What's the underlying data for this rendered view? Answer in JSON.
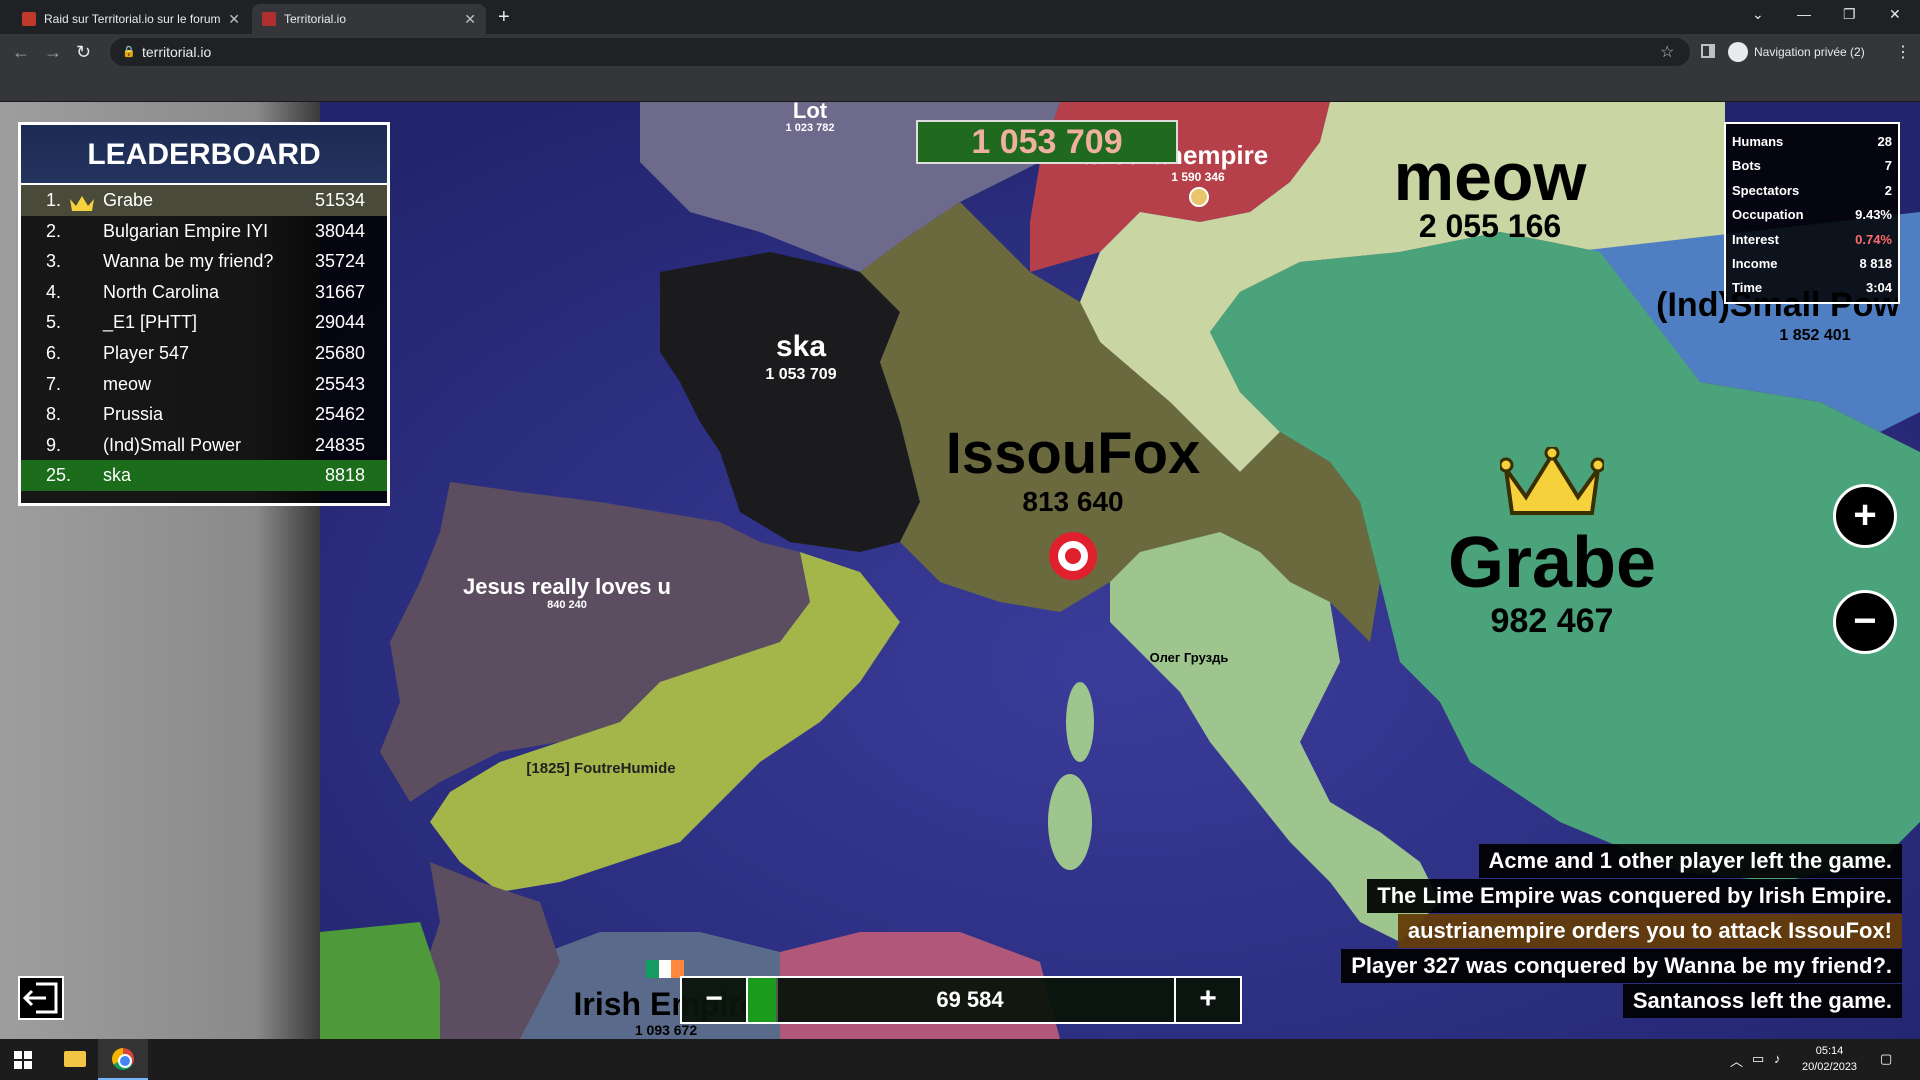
{
  "browser": {
    "tabs": [
      {
        "label": "Raid sur Territorial.io sur le forum"
      },
      {
        "label": "Territorial.io"
      }
    ],
    "url": "territorial.io",
    "private_label": "Navigation privée (2)"
  },
  "leaderboard": {
    "title": "LEADERBOARD",
    "rows": [
      {
        "rank": "1.",
        "name": "Grabe",
        "score": "51534"
      },
      {
        "rank": "2.",
        "name": "Bulgarian Empire IYI",
        "score": "38044"
      },
      {
        "rank": "3.",
        "name": "Wanna be my friend?",
        "score": "35724"
      },
      {
        "rank": "4.",
        "name": "North Carolina",
        "score": "31667"
      },
      {
        "rank": "5.",
        "name": "_E1 [PHTT]",
        "score": "29044"
      },
      {
        "rank": "6.",
        "name": "Player 547",
        "score": "25680"
      },
      {
        "rank": "7.",
        "name": "meow",
        "score": "25543"
      },
      {
        "rank": "8.",
        "name": "Prussia",
        "score": "25462"
      },
      {
        "rank": "9.",
        "name": "(Ind)Small Power",
        "score": "24835"
      },
      {
        "rank": "25.",
        "name": "ska",
        "score": "8818"
      }
    ]
  },
  "top_counter": "1 053 709",
  "stats": [
    {
      "label": "Humans",
      "value": "28"
    },
    {
      "label": "Bots",
      "value": "7"
    },
    {
      "label": "Spectators",
      "value": "2"
    },
    {
      "label": "Occupation",
      "value": "9.43%"
    },
    {
      "label": "Interest",
      "value": "0.74%"
    },
    {
      "label": "Income",
      "value": "8 818"
    },
    {
      "label": "Time",
      "value": "3:04"
    }
  ],
  "territories": {
    "lot": {
      "name": "Lot",
      "value": "1 023 782"
    },
    "austrian": {
      "name": "austrianempire",
      "value": "1 590 346"
    },
    "meow": {
      "name": "meow",
      "value": "2 055 166"
    },
    "smallpower": {
      "name": "(Ind)Small Pow",
      "value": "1 852 401"
    },
    "ska": {
      "name": "ska",
      "value": "1 053 709"
    },
    "issoufox": {
      "name": "IssouFox",
      "value": "813 640"
    },
    "grabe": {
      "name": "Grabe",
      "value": "982 467"
    },
    "jesus": {
      "name": "Jesus really loves u",
      "value": "840 240"
    },
    "oleg": {
      "name": "Олег Груздь"
    },
    "foutre": {
      "name": "[1825] FoutreHumide"
    },
    "irish": {
      "name": "Irish Empire",
      "value": "1 093 672"
    }
  },
  "chat": [
    {
      "text": "Acme and 1 other player left the game."
    },
    {
      "text": "The Lime Empire was conquered by Irish Empire."
    },
    {
      "text": "austrianempire orders you to attack IssouFox!"
    },
    {
      "text": "Player 327 was conquered by Wanna be my friend?."
    },
    {
      "text": "Santanoss left the game."
    }
  ],
  "attack": {
    "value": "69 584",
    "minus": "−",
    "plus": "+",
    "ratio": 0.05
  },
  "zoom": {
    "in": "+",
    "out": "−"
  },
  "taskbar": {
    "time": "05:14",
    "date": "20/02/2023"
  }
}
